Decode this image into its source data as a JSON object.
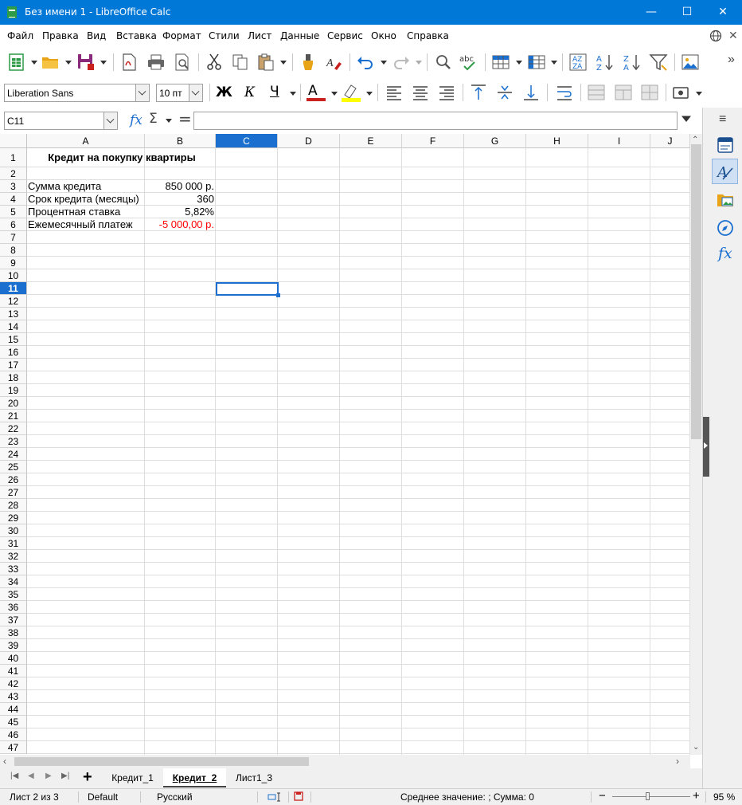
{
  "window": {
    "title": "Без имени 1 - LibreOffice Calc",
    "minimize": "—",
    "maximize": "☐",
    "close": "✕"
  },
  "menu": [
    {
      "label": "Файл"
    },
    {
      "label": "Правка"
    },
    {
      "label": "Вид"
    },
    {
      "label": "Вставка"
    },
    {
      "label": "Формат"
    },
    {
      "label": "Стили"
    },
    {
      "label": "Лист"
    },
    {
      "label": "Данные"
    },
    {
      "label": "Сервис"
    },
    {
      "label": "Окно"
    },
    {
      "label": "Справка"
    }
  ],
  "formatting": {
    "font_name": "Liberation Sans",
    "font_size": "10 пт",
    "bold": "Ж",
    "italic": "К",
    "underline": "Ч",
    "font_color_letter": "A",
    "font_color": "#c9211e",
    "highlight_color": "#ffff00"
  },
  "formula_bar": {
    "name_box": "C11",
    "fx": "fx",
    "sum": "Σ",
    "equals": "=",
    "content": ""
  },
  "grid": {
    "columns": [
      "A",
      "B",
      "C",
      "D",
      "E",
      "F",
      "G",
      "H",
      "I",
      "J"
    ],
    "selected_column": "C",
    "selected_row": "11",
    "selected_cell": "C11",
    "rows": [
      "1",
      "2",
      "3",
      "4",
      "5",
      "6",
      "7",
      "8",
      "9",
      "10",
      "11",
      "12",
      "13",
      "14",
      "15",
      "16",
      "17",
      "18",
      "19",
      "20",
      "21",
      "22",
      "23",
      "24",
      "25",
      "26",
      "27",
      "28",
      "29",
      "30",
      "31",
      "32",
      "33",
      "34",
      "35",
      "36",
      "37",
      "38",
      "39",
      "40",
      "41",
      "42",
      "43",
      "44",
      "45",
      "46",
      "47"
    ],
    "cells": {
      "A1": "Кредит на покупку квартиры",
      "A3": "Сумма кредита",
      "B3": "850 000 р.",
      "A4": "Срок кредита (месяцы)",
      "B4": "360",
      "A5": "Процентная ставка",
      "B5": "5,82%",
      "A6": "Ежемесячный платеж",
      "B6": "-5 000,00 р."
    },
    "negative_color": "#ff0000"
  },
  "sheet_tabs": [
    {
      "label": "Кредит_1",
      "active": false
    },
    {
      "label": "Кредит_2",
      "active": true
    },
    {
      "label": "Лист1_3",
      "active": false
    }
  ],
  "status": {
    "sheet_info": "Лист 2 из 3",
    "page_style": "Default",
    "language": "Русский",
    "summary": "Среднее значение: ; Сумма: 0",
    "zoom": "95 %",
    "zoom_minus": "−",
    "zoom_plus": "+"
  },
  "accent_color": "#0078d7",
  "selection_color": "#1a6fcf"
}
